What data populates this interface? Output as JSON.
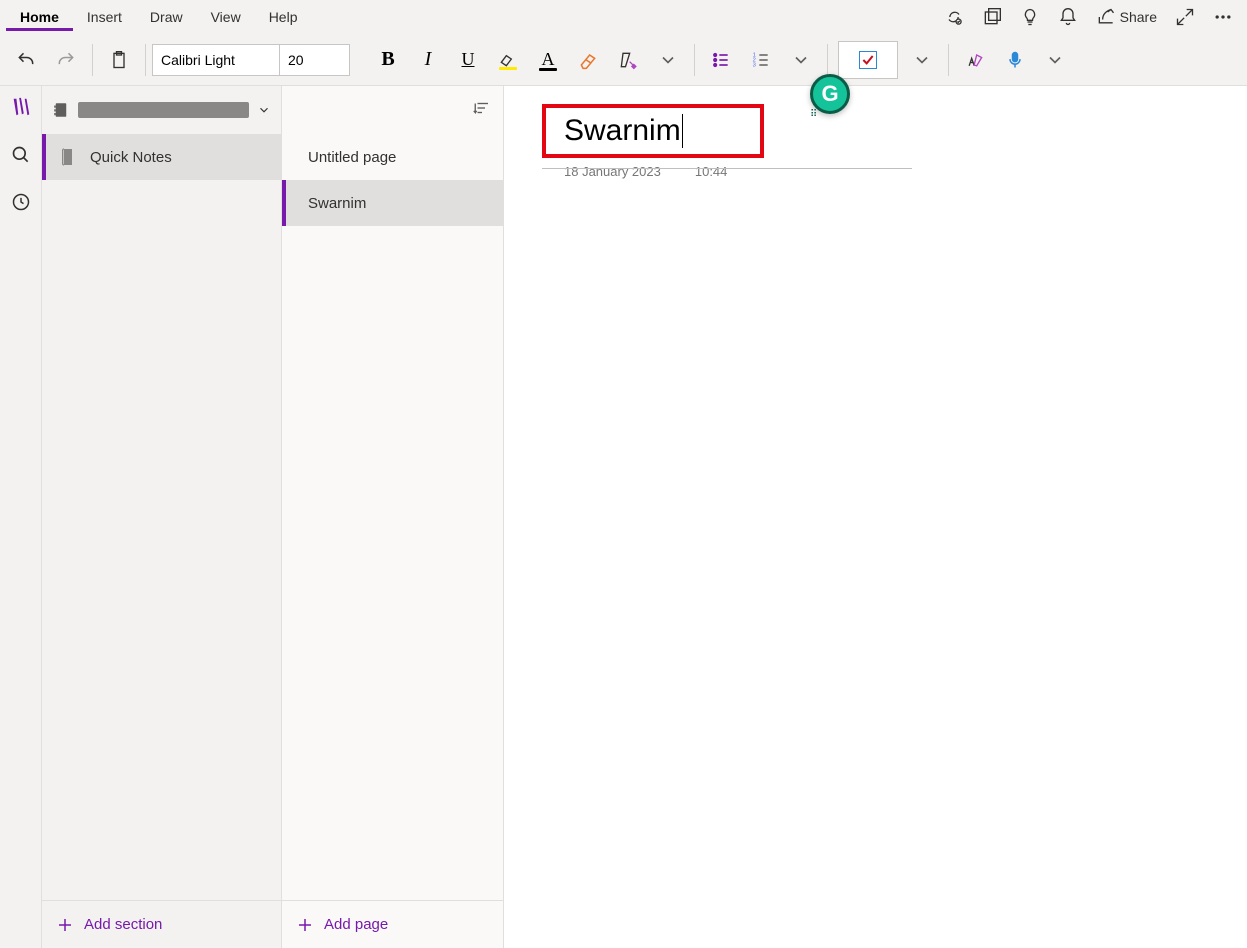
{
  "menu": {
    "items": [
      "Home",
      "Insert",
      "Draw",
      "View",
      "Help"
    ],
    "active_index": 0,
    "share_label": "Share"
  },
  "toolbar": {
    "font_name": "Calibri Light",
    "font_size": "20"
  },
  "sections": {
    "items": [
      {
        "label": "Quick Notes",
        "active": true
      }
    ],
    "add_label": "Add section"
  },
  "pages": {
    "items": [
      {
        "label": "Untitled page",
        "active": false
      },
      {
        "label": "Swarnim",
        "active": true
      }
    ],
    "add_label": "Add page"
  },
  "note": {
    "title": "Swarnim",
    "date": "18 January 2023",
    "time": "10:44"
  }
}
